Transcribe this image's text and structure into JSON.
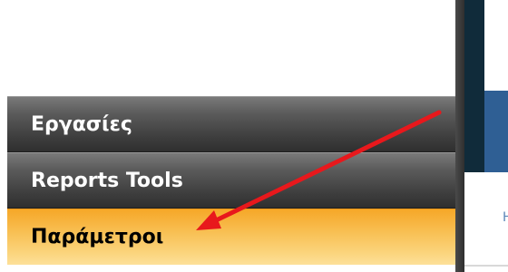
{
  "menu": {
    "items": [
      {
        "label": "Εργασίες",
        "state": "normal"
      },
      {
        "label": "Reports Tools",
        "state": "normal"
      },
      {
        "label": "Παράμετροι",
        "state": "active"
      }
    ]
  },
  "colors": {
    "menu_dark": "#3d3d3d",
    "menu_active": "#f8bf52",
    "annotation_arrow": "#e8181c",
    "panel_dark": "#102b3a",
    "panel_blue": "#2f5f94"
  },
  "annotation": {
    "icon": "arrow-icon"
  }
}
